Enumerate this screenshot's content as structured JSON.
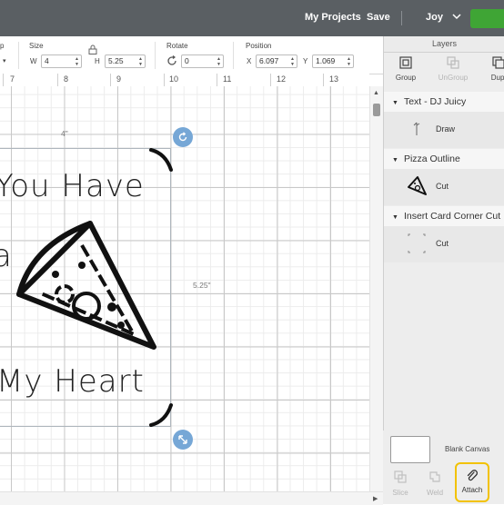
{
  "topbar": {
    "my_projects": "My Projects",
    "save": "Save",
    "user": "Joy"
  },
  "toolbar": {
    "partial_label": "p",
    "size_label": "Size",
    "w_label": "W",
    "w_value": "4",
    "h_label": "H",
    "h_value": "5.25",
    "rotate_label": "Rotate",
    "rotate_value": "0",
    "position_label": "Position",
    "x_label": "X",
    "x_value": "6.097",
    "y_label": "Y",
    "y_value": "1.069"
  },
  "ruler": {
    "ticks": [
      "7",
      "8",
      "9",
      "10",
      "11",
      "12",
      "13"
    ]
  },
  "canvas": {
    "width_dim": "4\"",
    "height_dim": "5.25\"",
    "text_line1": "You Have",
    "text_line2": "a",
    "text_line3": "My Heart"
  },
  "layers": {
    "title": "Layers",
    "buttons": {
      "group": "Group",
      "ungroup": "UnGroup",
      "duplicate": "Dupl"
    },
    "items": [
      {
        "name": "Text - DJ Juicy",
        "operation": "Draw"
      },
      {
        "name": "Pizza Outline",
        "operation": "Cut"
      },
      {
        "name": "Insert Card Corner Cut",
        "operation": "Cut"
      }
    ],
    "blank_canvas": "Blank Canvas",
    "bottom": {
      "slice": "Slice",
      "weld": "Weld",
      "attach": "Attach"
    }
  },
  "colors": {
    "topbar": "#5a5f63",
    "accent_green": "#3fa535",
    "highlight": "#f2c200",
    "handle": "#76a7d6"
  }
}
